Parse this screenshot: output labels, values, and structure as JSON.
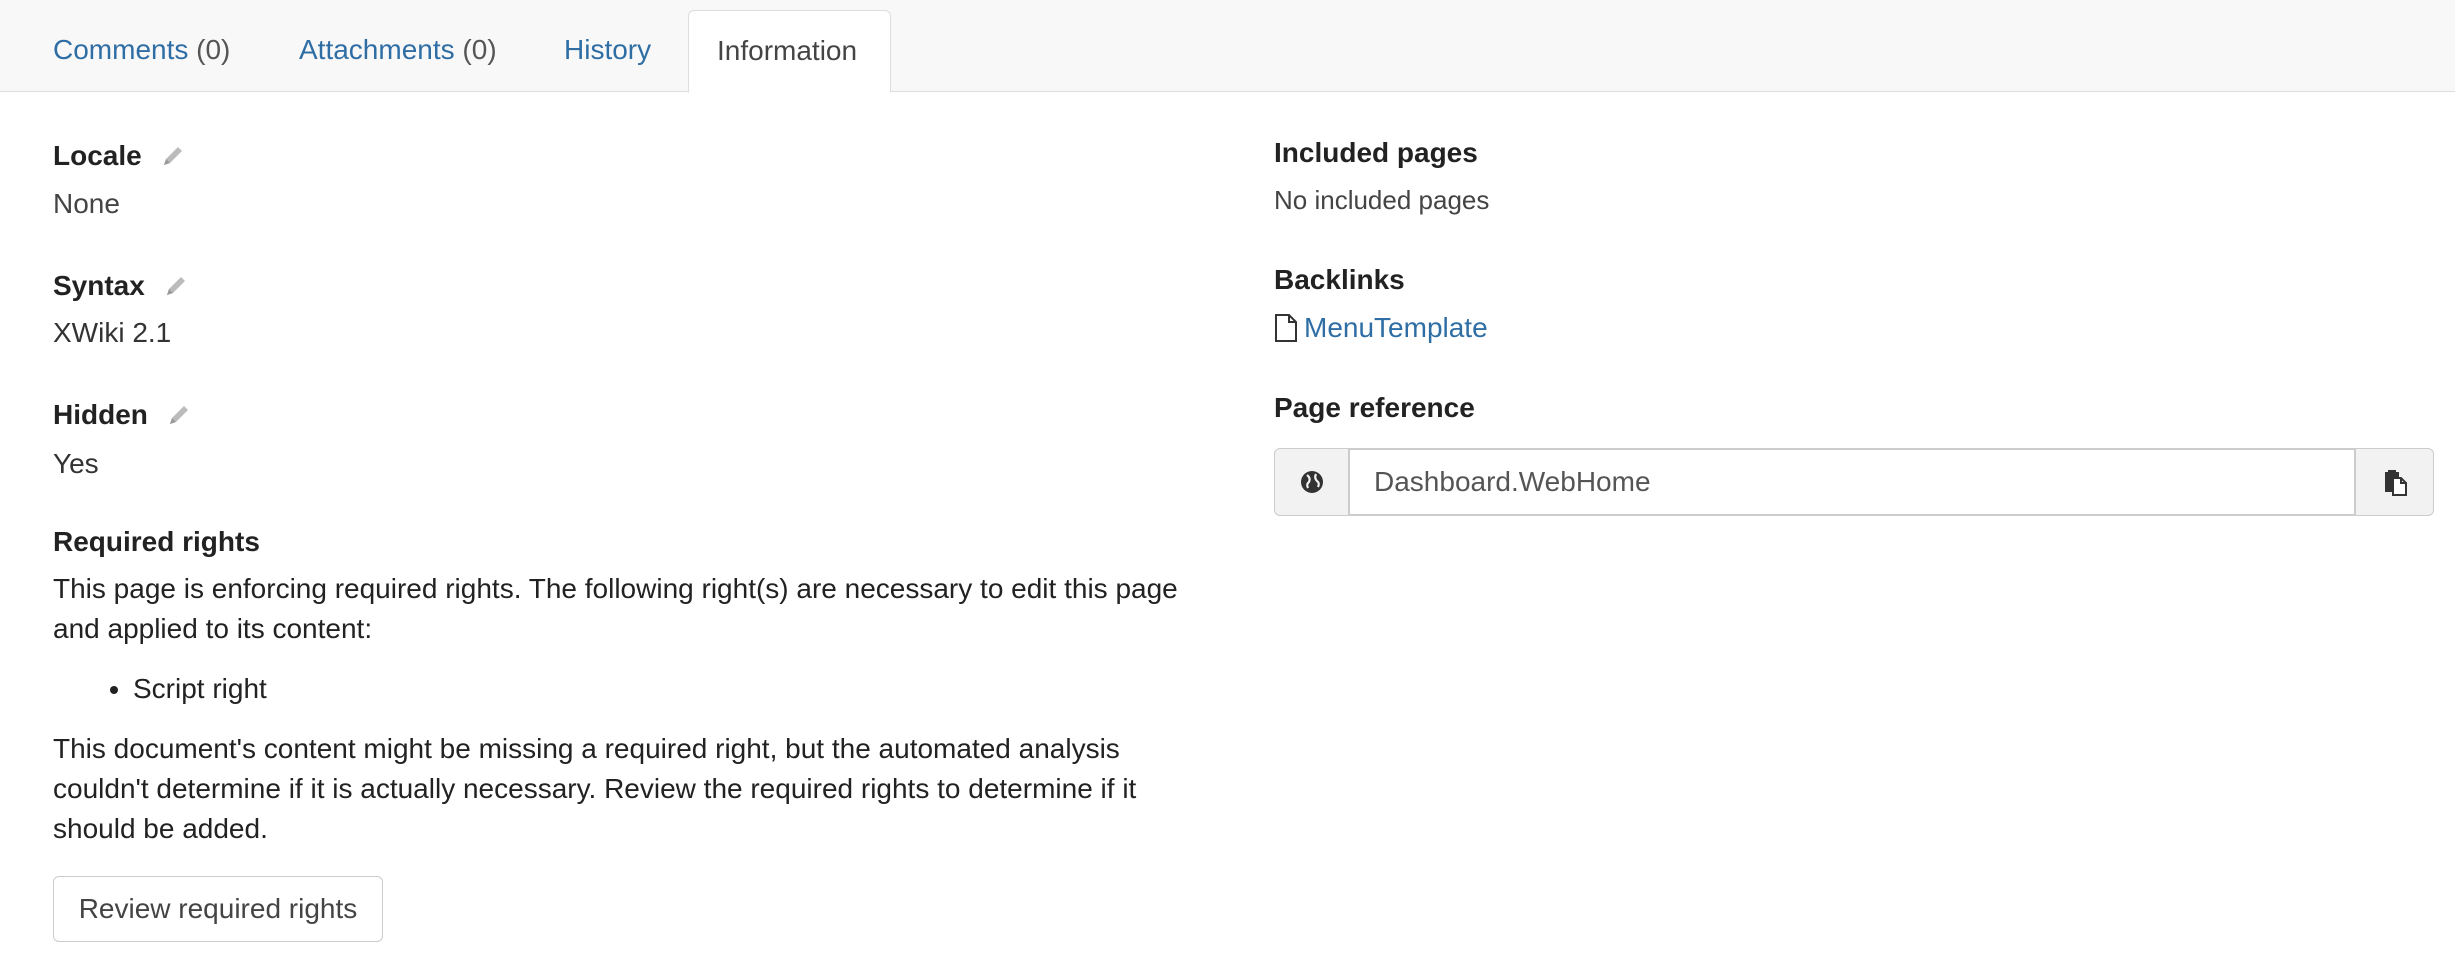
{
  "tabs": [
    {
      "label": "Comments",
      "count": "(0)"
    },
    {
      "label": "Attachments",
      "count": "(0)"
    },
    {
      "label": "History",
      "count": ""
    },
    {
      "label": "Information",
      "count": "",
      "active": true
    }
  ],
  "left": {
    "locale": {
      "label": "Locale",
      "value": "None"
    },
    "syntax": {
      "label": "Syntax",
      "value": "XWiki 2.1"
    },
    "hidden": {
      "label": "Hidden",
      "value": "Yes"
    },
    "required_rights": {
      "label": "Required rights",
      "text1": "This page is enforcing required rights. The following right(s) are necessary to edit this page and applied to its content:",
      "items": [
        "Script right"
      ],
      "text2": "This document's content might be missing a required right, but the automated analysis couldn't determine if it is actually necessary. Review the required rights to determine if it should be added.",
      "button": "Review required rights"
    }
  },
  "right": {
    "included_pages": {
      "label": "Included pages",
      "value": "No included pages"
    },
    "backlinks": {
      "label": "Backlinks",
      "items": [
        "MenuTemplate"
      ]
    },
    "page_reference": {
      "label": "Page reference",
      "value": "Dashboard.WebHome"
    }
  },
  "colors": {
    "link": "#2f6ea5",
    "tab_bar": "#f8f8f8",
    "border": "#dddddd"
  },
  "icons": [
    "pencil-icon",
    "file-icon",
    "globe-icon",
    "clipboard-icon"
  ]
}
